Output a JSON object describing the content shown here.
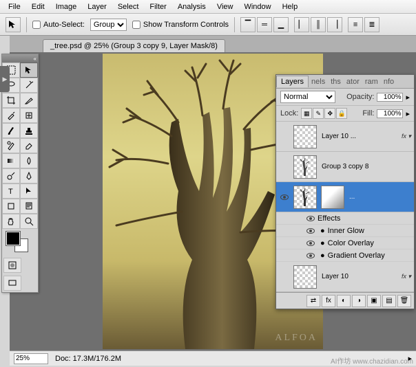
{
  "menu": {
    "file": "File",
    "edit": "Edit",
    "image": "Image",
    "layer": "Layer",
    "select": "Select",
    "filter": "Filter",
    "analysis": "Analysis",
    "view": "View",
    "window": "Window",
    "help": "Help"
  },
  "options": {
    "auto_select_label": "Auto-Select:",
    "group_dropdown": "Group",
    "show_transform_label": "Show Transform Controls"
  },
  "doc": {
    "tab_title": "_tree.psd @ 25% (Group 3 copy 9, Layer Mask/8)",
    "zoom": "25%",
    "doc_size": "Doc: 17.3M/176.2M",
    "watermark": "ALFOA"
  },
  "panel": {
    "tabs": {
      "layers": "Layers",
      "channels": "nels",
      "paths": "ths",
      "history": "ator",
      "actions": "ram",
      "info": "nfo"
    },
    "blend_mode": "Normal",
    "opacity_label": "Opacity:",
    "opacity_value": "100%",
    "lock_label": "Lock:",
    "fill_label": "Fill:",
    "fill_value": "100%",
    "layers": [
      {
        "name": "Layer 10 ...",
        "fx": true
      },
      {
        "name": "Group 3 copy 8"
      },
      {
        "name": "",
        "selected": true,
        "mask": true,
        "fx_dots": "..."
      },
      {
        "name": "Layer 10",
        "fx": true
      }
    ],
    "effects_label": "Effects",
    "fx_items": [
      "Inner Glow",
      "Color Overlay",
      "Gradient Overlay"
    ]
  },
  "watermark_site": "AI作坊 www.chazidian.com"
}
